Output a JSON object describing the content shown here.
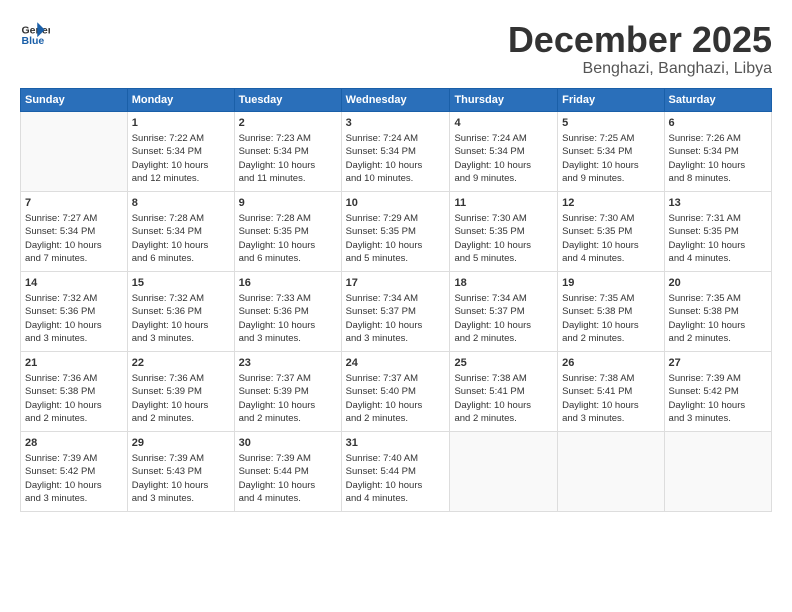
{
  "logo": {
    "line1": "General",
    "line2": "Blue"
  },
  "title": "December 2025",
  "location": "Benghazi, Banghazi, Libya",
  "days_of_week": [
    "Sunday",
    "Monday",
    "Tuesday",
    "Wednesday",
    "Thursday",
    "Friday",
    "Saturday"
  ],
  "weeks": [
    [
      {
        "day": "",
        "content": ""
      },
      {
        "day": "1",
        "content": "Sunrise: 7:22 AM\nSunset: 5:34 PM\nDaylight: 10 hours\nand 12 minutes."
      },
      {
        "day": "2",
        "content": "Sunrise: 7:23 AM\nSunset: 5:34 PM\nDaylight: 10 hours\nand 11 minutes."
      },
      {
        "day": "3",
        "content": "Sunrise: 7:24 AM\nSunset: 5:34 PM\nDaylight: 10 hours\nand 10 minutes."
      },
      {
        "day": "4",
        "content": "Sunrise: 7:24 AM\nSunset: 5:34 PM\nDaylight: 10 hours\nand 9 minutes."
      },
      {
        "day": "5",
        "content": "Sunrise: 7:25 AM\nSunset: 5:34 PM\nDaylight: 10 hours\nand 9 minutes."
      },
      {
        "day": "6",
        "content": "Sunrise: 7:26 AM\nSunset: 5:34 PM\nDaylight: 10 hours\nand 8 minutes."
      }
    ],
    [
      {
        "day": "7",
        "content": "Sunrise: 7:27 AM\nSunset: 5:34 PM\nDaylight: 10 hours\nand 7 minutes."
      },
      {
        "day": "8",
        "content": "Sunrise: 7:28 AM\nSunset: 5:34 PM\nDaylight: 10 hours\nand 6 minutes."
      },
      {
        "day": "9",
        "content": "Sunrise: 7:28 AM\nSunset: 5:35 PM\nDaylight: 10 hours\nand 6 minutes."
      },
      {
        "day": "10",
        "content": "Sunrise: 7:29 AM\nSunset: 5:35 PM\nDaylight: 10 hours\nand 5 minutes."
      },
      {
        "day": "11",
        "content": "Sunrise: 7:30 AM\nSunset: 5:35 PM\nDaylight: 10 hours\nand 5 minutes."
      },
      {
        "day": "12",
        "content": "Sunrise: 7:30 AM\nSunset: 5:35 PM\nDaylight: 10 hours\nand 4 minutes."
      },
      {
        "day": "13",
        "content": "Sunrise: 7:31 AM\nSunset: 5:35 PM\nDaylight: 10 hours\nand 4 minutes."
      }
    ],
    [
      {
        "day": "14",
        "content": "Sunrise: 7:32 AM\nSunset: 5:36 PM\nDaylight: 10 hours\nand 3 minutes."
      },
      {
        "day": "15",
        "content": "Sunrise: 7:32 AM\nSunset: 5:36 PM\nDaylight: 10 hours\nand 3 minutes."
      },
      {
        "day": "16",
        "content": "Sunrise: 7:33 AM\nSunset: 5:36 PM\nDaylight: 10 hours\nand 3 minutes."
      },
      {
        "day": "17",
        "content": "Sunrise: 7:34 AM\nSunset: 5:37 PM\nDaylight: 10 hours\nand 3 minutes."
      },
      {
        "day": "18",
        "content": "Sunrise: 7:34 AM\nSunset: 5:37 PM\nDaylight: 10 hours\nand 2 minutes."
      },
      {
        "day": "19",
        "content": "Sunrise: 7:35 AM\nSunset: 5:38 PM\nDaylight: 10 hours\nand 2 minutes."
      },
      {
        "day": "20",
        "content": "Sunrise: 7:35 AM\nSunset: 5:38 PM\nDaylight: 10 hours\nand 2 minutes."
      }
    ],
    [
      {
        "day": "21",
        "content": "Sunrise: 7:36 AM\nSunset: 5:38 PM\nDaylight: 10 hours\nand 2 minutes."
      },
      {
        "day": "22",
        "content": "Sunrise: 7:36 AM\nSunset: 5:39 PM\nDaylight: 10 hours\nand 2 minutes."
      },
      {
        "day": "23",
        "content": "Sunrise: 7:37 AM\nSunset: 5:39 PM\nDaylight: 10 hours\nand 2 minutes."
      },
      {
        "day": "24",
        "content": "Sunrise: 7:37 AM\nSunset: 5:40 PM\nDaylight: 10 hours\nand 2 minutes."
      },
      {
        "day": "25",
        "content": "Sunrise: 7:38 AM\nSunset: 5:41 PM\nDaylight: 10 hours\nand 2 minutes."
      },
      {
        "day": "26",
        "content": "Sunrise: 7:38 AM\nSunset: 5:41 PM\nDaylight: 10 hours\nand 3 minutes."
      },
      {
        "day": "27",
        "content": "Sunrise: 7:39 AM\nSunset: 5:42 PM\nDaylight: 10 hours\nand 3 minutes."
      }
    ],
    [
      {
        "day": "28",
        "content": "Sunrise: 7:39 AM\nSunset: 5:42 PM\nDaylight: 10 hours\nand 3 minutes."
      },
      {
        "day": "29",
        "content": "Sunrise: 7:39 AM\nSunset: 5:43 PM\nDaylight: 10 hours\nand 3 minutes."
      },
      {
        "day": "30",
        "content": "Sunrise: 7:39 AM\nSunset: 5:44 PM\nDaylight: 10 hours\nand 4 minutes."
      },
      {
        "day": "31",
        "content": "Sunrise: 7:40 AM\nSunset: 5:44 PM\nDaylight: 10 hours\nand 4 minutes."
      },
      {
        "day": "",
        "content": ""
      },
      {
        "day": "",
        "content": ""
      },
      {
        "day": "",
        "content": ""
      }
    ]
  ]
}
